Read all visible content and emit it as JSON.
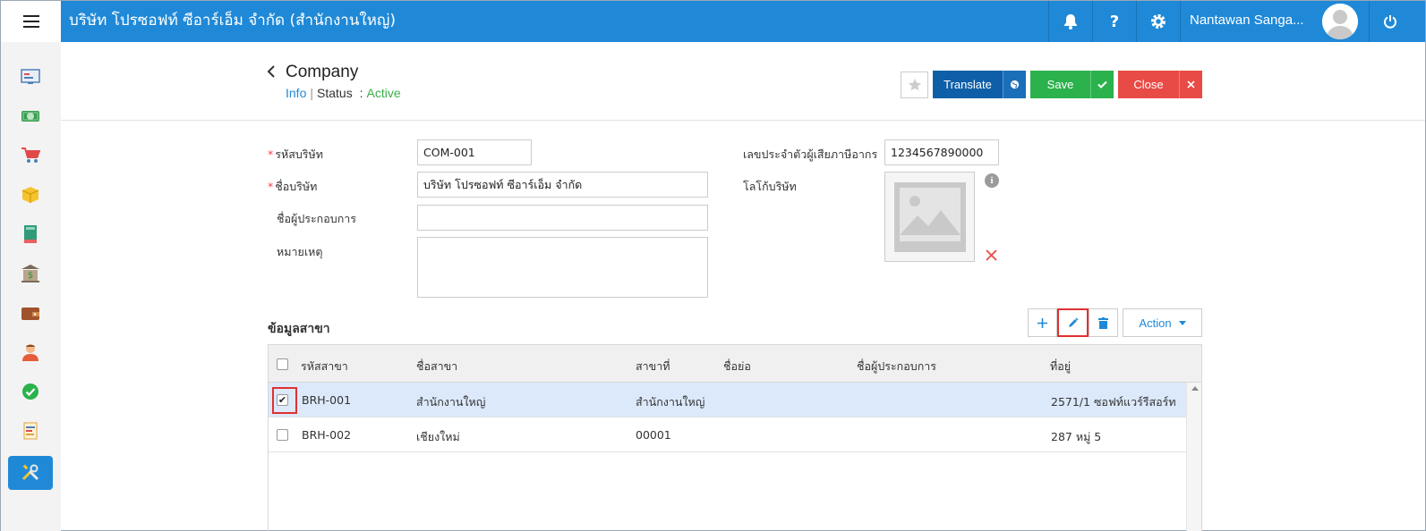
{
  "topbar": {
    "company_title": "บริษัท โปรซอฟท์ ซีอาร์เอ็ม จำกัด (สำนักงานใหญ่)",
    "user_name": "Nantawan Sanga...",
    "help_label": "?",
    "color": "#1f89d8"
  },
  "sidebar": {
    "items": [
      {
        "icon": "dashboard-icon"
      },
      {
        "icon": "money-icon"
      },
      {
        "icon": "cart-icon"
      },
      {
        "icon": "box-icon"
      },
      {
        "icon": "book-icon"
      },
      {
        "icon": "bank-icon"
      },
      {
        "icon": "wallet-icon"
      },
      {
        "icon": "people-icon"
      },
      {
        "icon": "approve-icon"
      },
      {
        "icon": "report-icon"
      },
      {
        "icon": "tools-icon",
        "active": true
      }
    ]
  },
  "header": {
    "title": "Company",
    "info_link": "Info",
    "separator": "|",
    "status_label": "Status",
    "status_colon": ":",
    "status_value": "Active",
    "translate_label": "Translate",
    "save_label": "Save",
    "close_label": "Close"
  },
  "form": {
    "company_code_label": "รหัสบริษัท",
    "company_code_value": "COM-001",
    "company_name_label": "ชื่อบริษัท",
    "company_name_value": "บริษัท โปรซอฟท์ ซีอาร์เอ็ม จำกัด",
    "operator_name_label": "ชื่อผู้ประกอบการ",
    "operator_name_value": "",
    "remark_label": "หมายเหตุ",
    "remark_value": "",
    "tax_id_label": "เลขประจำตัวผู้เสียภาษีอากร",
    "tax_id_value": "1234567890000",
    "logo_label": "โลโก้บริษัท",
    "required_mark": "*"
  },
  "branches": {
    "title": "ข้อมูลสาขา",
    "action_label": "Action",
    "columns": [
      "รหัสสาขา",
      "ชื่อสาขา",
      "สาขาที่",
      "ชื่อย่อ",
      "ชื่อผู้ประกอบการ",
      "ที่อยู่"
    ],
    "rows": [
      {
        "code": "BRH-001",
        "name": "สำนักงานใหญ่",
        "branch_no": "สำนักงานใหญ่",
        "short": "",
        "operator": "",
        "address": "2571/1 ซอฟท์แวร์รีสอร์ท",
        "checked": true
      },
      {
        "code": "BRH-002",
        "name": "เชียงใหม่",
        "branch_no": "00001",
        "short": "",
        "operator": "",
        "address": "287 หมู่ 5",
        "checked": false
      }
    ]
  }
}
